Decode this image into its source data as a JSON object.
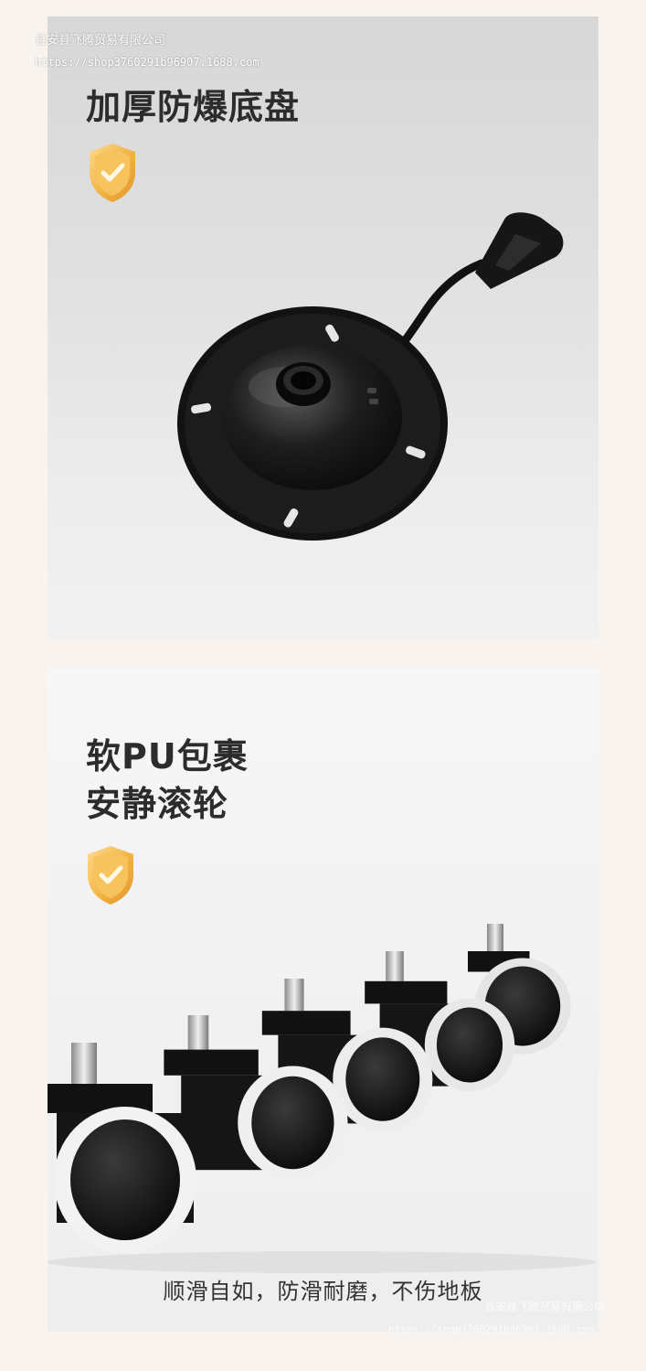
{
  "watermark": {
    "company": "县安县飞腾贸易有限公司",
    "url": "https://shop3760291b96907.1688.com"
  },
  "sections": [
    {
      "title": "加厚防爆底盘",
      "icon": "shield-check-icon"
    },
    {
      "title_line1": "软PU包裹",
      "title_line2": "安静滚轮",
      "icon": "shield-check-icon",
      "caption": "顺滑自如，防滑耐磨，不伤地板"
    }
  ],
  "colors": {
    "page_bg": "#f8f3ee",
    "badge_gold": "#f2b13a",
    "title_text": "#2c2c2c"
  }
}
